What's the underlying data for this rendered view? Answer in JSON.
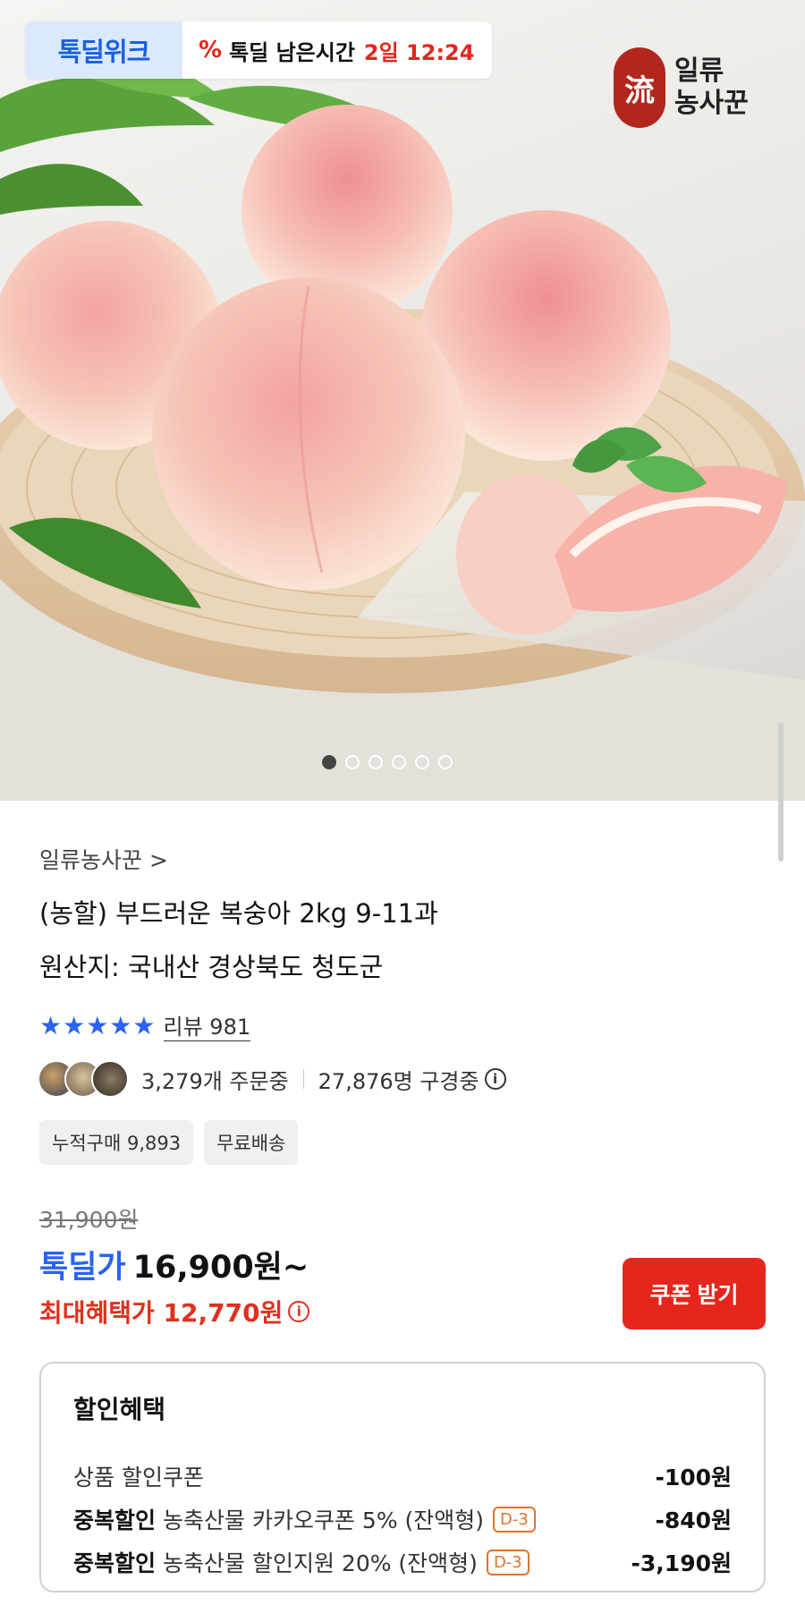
{
  "hero": {
    "deal_brand": "톡딜위크",
    "timer_label": "톡딜 남은시간",
    "timer_value": "2일 12:24",
    "seller_logo_text_line1": "일류",
    "seller_logo_text_line2": "농사꾼",
    "seal_glyph": "一流",
    "carousel_total": 6,
    "carousel_active": 1
  },
  "product": {
    "seller_link": "일류농사꾼 >",
    "title_line1": "(농할) 부드러운 복숭아 2kg 9-11과",
    "title_line2": "원산지: 국내산 경상북도 청도군",
    "stars": "★★★★★",
    "review_link": "리뷰 981",
    "orders": "3,279개 주문중",
    "watching": "27,876명 구경중",
    "chips": [
      "누적구매 9,893",
      "무료배송"
    ]
  },
  "price": {
    "original": "31,900원",
    "deal_label": "톡딜가",
    "deal_value": "16,900원~",
    "max_benefit": "최대혜택가 12,770원",
    "coupon_button": "쿠폰 받기"
  },
  "benefits": {
    "title": "할인혜택",
    "rows": [
      {
        "bold": "",
        "label": "상품 할인쿠폰",
        "badge": "",
        "amount": "-100원"
      },
      {
        "bold": "중복할인",
        "label": "농축산물 카카오쿠폰 5% (잔액형)",
        "badge": "D-3",
        "amount": "-840원"
      },
      {
        "bold": "중복할인",
        "label": "농축산물 할인지원 20% (잔액형)",
        "badge": "D-3",
        "amount": "-3,190원"
      }
    ]
  },
  "colors": {
    "accent_blue": "#2a63f0",
    "accent_red": "#e5261c",
    "badge_orange": "#e5712a"
  }
}
